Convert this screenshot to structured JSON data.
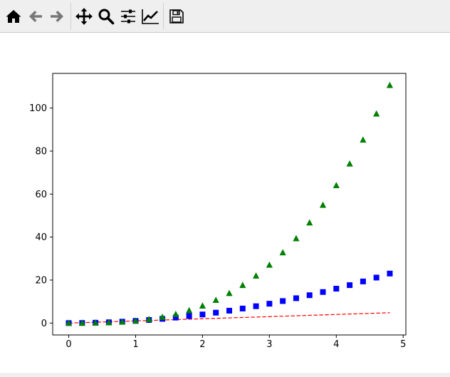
{
  "toolbar": {
    "buttons": [
      {
        "name": "home-button",
        "icon": "home-icon"
      },
      {
        "name": "back-button",
        "icon": "arrow-left-icon"
      },
      {
        "name": "forward-button",
        "icon": "arrow-right-icon"
      },
      {
        "name": "pan-button",
        "icon": "move-icon"
      },
      {
        "name": "zoom-button",
        "icon": "magnifier-icon"
      },
      {
        "name": "configure-subplots-button",
        "icon": "sliders-icon"
      },
      {
        "name": "edit-axes-button",
        "icon": "line-chart-icon"
      },
      {
        "name": "save-button",
        "icon": "floppy-disk-icon"
      }
    ]
  },
  "chart_data": {
    "type": "scatter",
    "title": "",
    "xlabel": "",
    "ylabel": "",
    "xlim": [
      -0.24,
      5.04
    ],
    "ylim": [
      -5.53,
      116.13
    ],
    "xticks": [
      "0",
      "1",
      "2",
      "3",
      "4",
      "5"
    ],
    "yticks": [
      "0",
      "20",
      "40",
      "60",
      "80",
      "100"
    ],
    "grid": false,
    "x": [
      0,
      0.2,
      0.4,
      0.6,
      0.8,
      1.0,
      1.2,
      1.4,
      1.6,
      1.8,
      2.0,
      2.2,
      2.4,
      2.6,
      2.8,
      3.0,
      3.2,
      3.4,
      3.6,
      3.8,
      4.0,
      4.2,
      4.4,
      4.6,
      4.8
    ],
    "series": [
      {
        "marker": "dash",
        "color": "#ff0000",
        "style": "r--",
        "values": [
          0,
          0.2,
          0.4,
          0.6,
          0.8,
          1.0,
          1.2,
          1.4,
          1.6,
          1.8,
          2.0,
          2.2,
          2.4,
          2.6,
          2.8,
          3.0,
          3.2,
          3.4,
          3.6,
          3.8,
          4.0,
          4.2,
          4.4,
          4.6,
          4.8
        ]
      },
      {
        "marker": "square",
        "color": "#0000ff",
        "style": "bs",
        "values": [
          0,
          0.04,
          0.16,
          0.36,
          0.64,
          1.0,
          1.44,
          1.96,
          2.56,
          3.24,
          4.0,
          4.84,
          5.76,
          6.76,
          7.84,
          9.0,
          10.24,
          11.56,
          12.96,
          14.44,
          16.0,
          17.64,
          19.36,
          21.16,
          23.04
        ]
      },
      {
        "marker": "triangle",
        "color": "#008000",
        "style": "g^",
        "values": [
          0,
          0.008,
          0.064,
          0.216,
          0.512,
          1.0,
          1.728,
          2.744,
          4.096,
          5.832,
          8.0,
          10.648,
          13.824,
          17.576,
          21.952,
          27.0,
          32.768,
          39.304,
          46.656,
          54.872,
          64.0,
          74.088,
          85.184,
          97.336,
          110.592
        ]
      }
    ]
  }
}
